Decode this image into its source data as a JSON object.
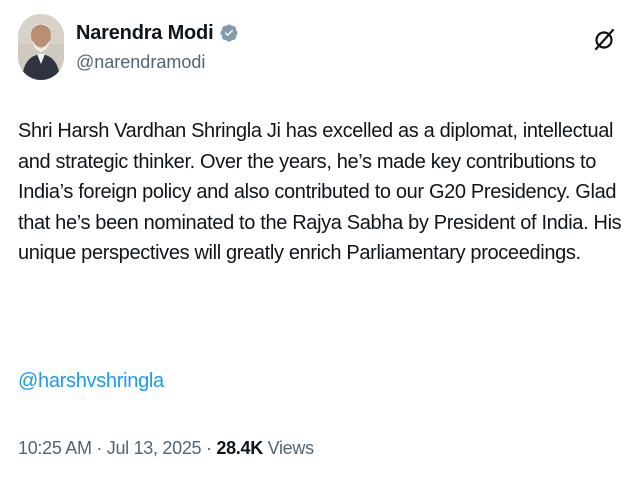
{
  "author": {
    "display_name": "Narendra Modi",
    "handle": "@narendramodi",
    "verified": true,
    "verified_color": "#829aab"
  },
  "tweet": {
    "text": "Shri Harsh Vardhan Shringla Ji has excelled as a diplomat, intellectual and strategic thinker. Over the years, he’s made key contributions to India’s foreign policy and also contributed to our G20 Presidency. Glad that he’s been nominated to the Rajya Sabha by President of India. His unique perspectives will greatly enrich Parliamentary proceedings.",
    "mention": "@harshvshringla"
  },
  "meta": {
    "time": "10:25 AM",
    "separator": " · ",
    "date": "Jul 13, 2025",
    "separator2": " · ",
    "views_count": "28.4K",
    "views_label": " Views"
  },
  "icons": {
    "verified": "verified-badge-icon",
    "grok": "grok-icon"
  },
  "colors": {
    "text": "#0f1419",
    "secondary": "#536471",
    "link": "#1d9bf0"
  }
}
